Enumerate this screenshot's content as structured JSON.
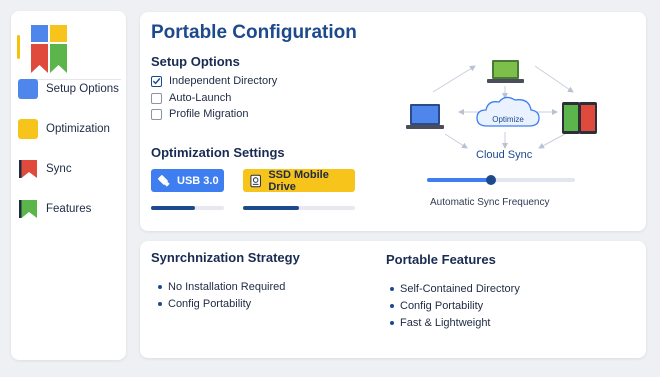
{
  "sidebar": {
    "items": [
      {
        "label": "Setup Options",
        "icon": "blue-square-icon",
        "color": "#4f86ec"
      },
      {
        "label": "Optimization",
        "icon": "yellow-square-icon",
        "color": "#f6c41a"
      },
      {
        "label": "Sync",
        "icon": "red-bookmark-icon",
        "color": "#e04a3c"
      },
      {
        "label": "Features",
        "icon": "green-bookmark-icon",
        "color": "#5bb54a"
      }
    ]
  },
  "main": {
    "title": "Portable Configuration",
    "setup": {
      "heading": "Setup Options",
      "options": [
        {
          "label": "Independent Directory",
          "checked": true
        },
        {
          "label": "Auto-Launch",
          "checked": false
        },
        {
          "label": "Profile Migration",
          "checked": false
        }
      ]
    },
    "optimization": {
      "heading": "Optimization Settings",
      "usb": {
        "label": "USB 3.0",
        "progress": 0.6
      },
      "ssd": {
        "label": "SSD Mobile Drive",
        "progress": 0.5
      }
    },
    "sync": {
      "center_label": "Optimize",
      "cloud_label": "Cloud Sync",
      "slider_label": "Automatic Sync Frequency",
      "slider_value": 0.43
    }
  },
  "bottom": {
    "strategy": {
      "heading": "Synrchnization Strategy",
      "items": [
        "No Installation Required",
        "Config Portability"
      ]
    },
    "features": {
      "heading": "Portable Features",
      "items": [
        "Self-Contained Directory",
        "Config Portability",
        "Fast & Lightweight"
      ]
    }
  },
  "colors": {
    "accent_blue": "#1d4a8c",
    "brand_blue": "#3e7ef0",
    "brand_yellow": "#f6c41a",
    "brand_red": "#e04a3c",
    "brand_green": "#5bb54a"
  }
}
